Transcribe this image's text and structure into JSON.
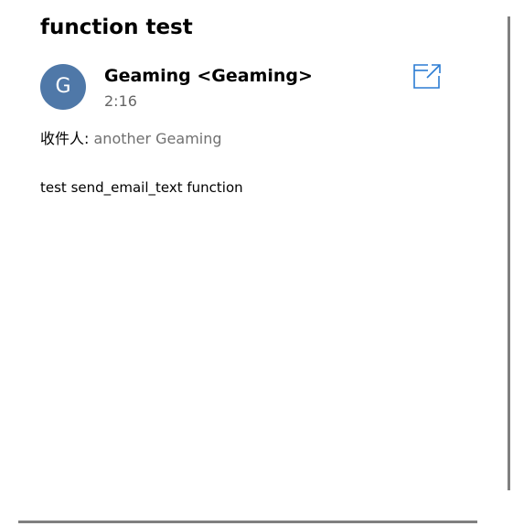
{
  "email": {
    "subject": "function test",
    "sender": {
      "initial": "G",
      "display": "Geaming <Geaming>",
      "avatar_color": "#4f78a8"
    },
    "time": "2:16",
    "to_label": "收件人:",
    "to_value": "another Geaming",
    "body": "test send_email_text function"
  },
  "icons": {
    "popout": "open-in-new-window-icon"
  },
  "colors": {
    "accent": "#2b7cd3",
    "muted_text": "#707070",
    "scrollbar": "#808080"
  }
}
